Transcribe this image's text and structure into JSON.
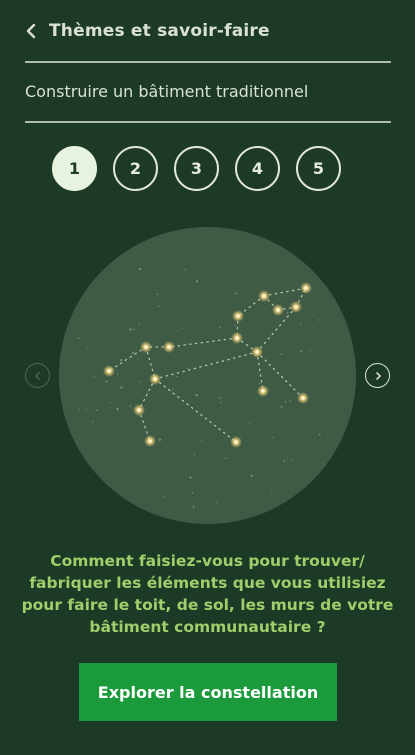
{
  "header": {
    "back_icon": "chevron-left-icon",
    "title": "Thèmes et savoir-faire"
  },
  "subtitle": "Construire un bâtiment traditionnel",
  "steps": [
    {
      "label": "1",
      "active": true
    },
    {
      "label": "2",
      "active": false
    },
    {
      "label": "3",
      "active": false
    },
    {
      "label": "4",
      "active": false
    },
    {
      "label": "5",
      "active": false
    }
  ],
  "carousel": {
    "prev_icon": "chevron-left-icon",
    "next_icon": "chevron-right-icon"
  },
  "question": "Comment faisiez-vous pour trouver/ fabriquer les éléments que vous utilisiez pour faire le toit, de sol, les murs de votre bâtiment communautaire ?",
  "cta_label": "Explorer la constellation",
  "colors": {
    "background": "#1d3a27",
    "circle": "#3f5b45",
    "question_text": "#9ecf6a",
    "cta": "#1b9a3c",
    "star": "#f3d27a"
  }
}
